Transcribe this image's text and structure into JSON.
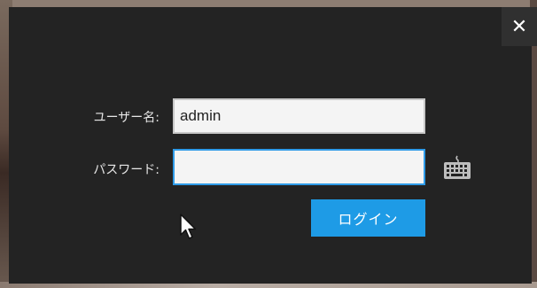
{
  "dialog": {
    "close_label": "✕"
  },
  "form": {
    "username_label": "ユーザー名:",
    "username_value": "admin",
    "password_label": "パスワード:",
    "password_value": "",
    "login_label": "ログイン"
  },
  "icons": {
    "close": "close-icon",
    "keyboard": "keyboard-icon",
    "cursor": "mouse-pointer-icon"
  },
  "colors": {
    "dialog_bg": "#232323",
    "accent": "#1e9be6",
    "focus_border": "#2f9be8"
  }
}
